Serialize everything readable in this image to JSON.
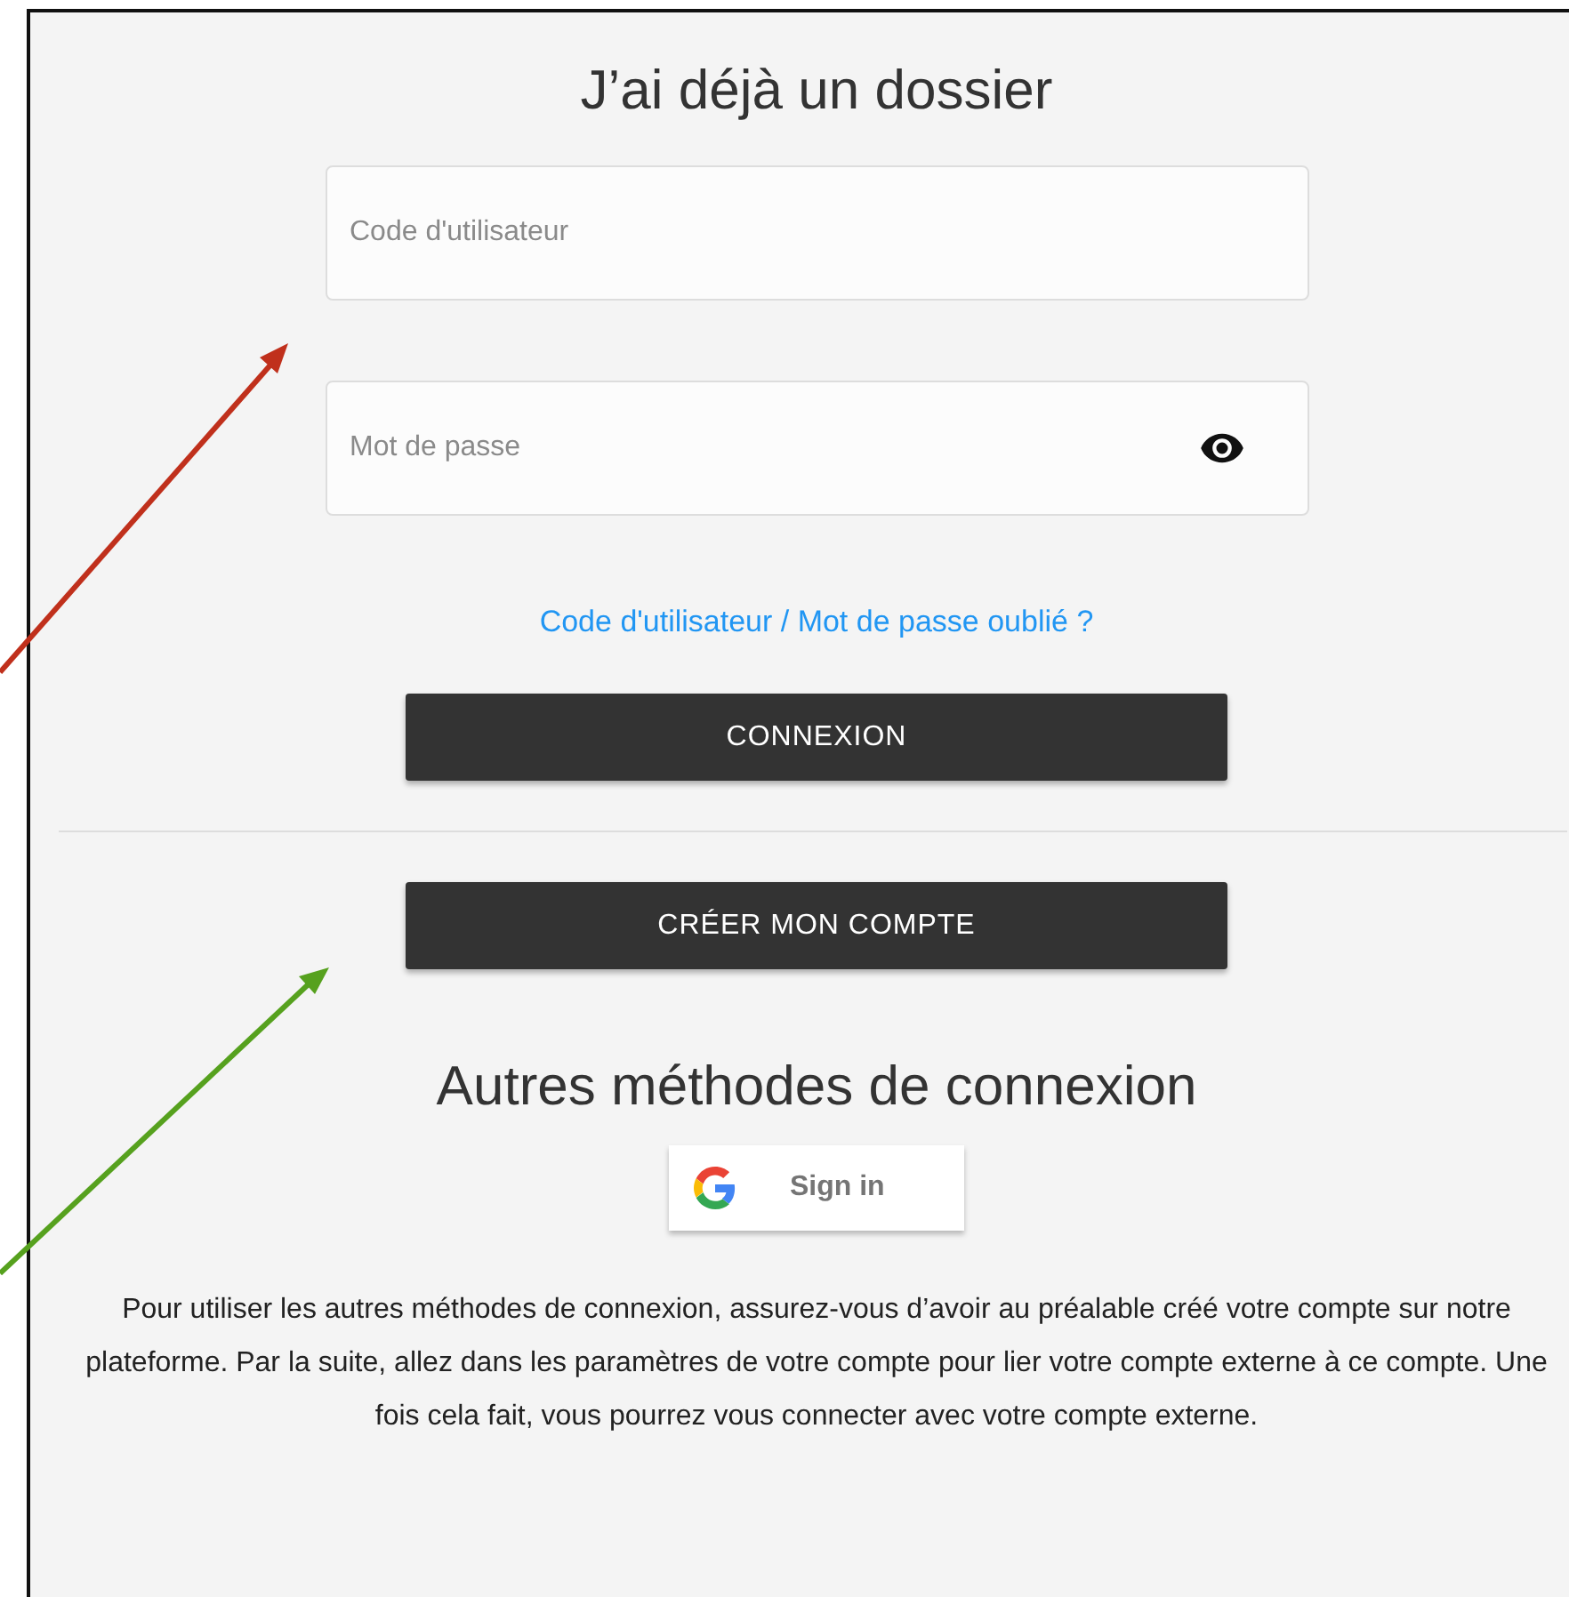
{
  "title": "J’ai déjà un dossier",
  "fields": [
    {
      "placeholder": "Code d'utilisateur",
      "kind": "text"
    },
    {
      "placeholder": "Mot de passe",
      "kind": "password"
    }
  ],
  "forgot_link": "Code d'utilisateur / Mot de passe oublié ?",
  "login_button": "CONNEXION",
  "create_button": "CRÉER MON COMPTE",
  "other_methods": {
    "title": "Autres méthodes de connexion",
    "google_button": "Sign in",
    "note": "Pour utiliser les autres méthodes de connexion, assurez-vous d’avoir au préalable créé votre compte sur notre plateforme. Par la suite, allez dans les paramètres de votre compte pour lier votre compte externe à ce compte. Une fois cela fait, vous pourrez vous connecter avec votre compte externe."
  }
}
